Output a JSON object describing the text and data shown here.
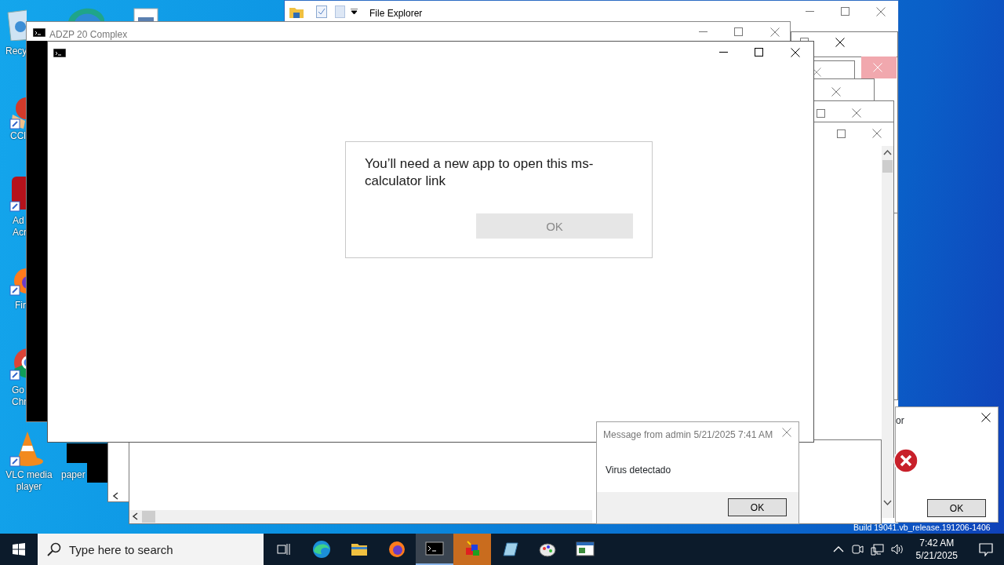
{
  "desktop_icons": [
    {
      "lines": [
        "Recy"
      ]
    },
    {
      "lines": [
        "CCl"
      ]
    },
    {
      "lines": [
        "Ad",
        "Acr"
      ]
    },
    {
      "lines": [
        "Fir"
      ]
    },
    {
      "lines": [
        "Go",
        "Chr"
      ]
    },
    {
      "lines": [
        "VLC media",
        "player"
      ]
    },
    {
      "lines": [
        "paper"
      ]
    }
  ],
  "file_explorer": {
    "title": "File Explorer"
  },
  "console_window": {
    "title": "ADZP 20 Complex"
  },
  "app_dialog": {
    "message": "You’ll need a new app to open this ms-calculator link",
    "button": {
      "label": "OK",
      "disabled": true
    }
  },
  "message_box": {
    "title": "Message from admin 5/21/2025 7:41 AM",
    "message": "Virus detectado",
    "button": "OK"
  },
  "error_dialog": {
    "title": "or",
    "button": "OK"
  },
  "build_text": "Build 19041.vb_release.191206-1406",
  "taskbar": {
    "search": {
      "placeholder": "Type here to search"
    },
    "apps": [
      {
        "selected": false,
        "attention": false
      },
      {
        "selected": false,
        "attention": false
      },
      {
        "selected": false,
        "attention": false
      },
      {
        "selected": true,
        "attention": false
      },
      {
        "selected": false,
        "attention": true
      },
      {
        "selected": false,
        "attention": false
      },
      {
        "selected": false,
        "attention": false
      },
      {
        "selected": false,
        "attention": false
      }
    ],
    "time": "7:42 AM",
    "date": "5/21/2025"
  }
}
